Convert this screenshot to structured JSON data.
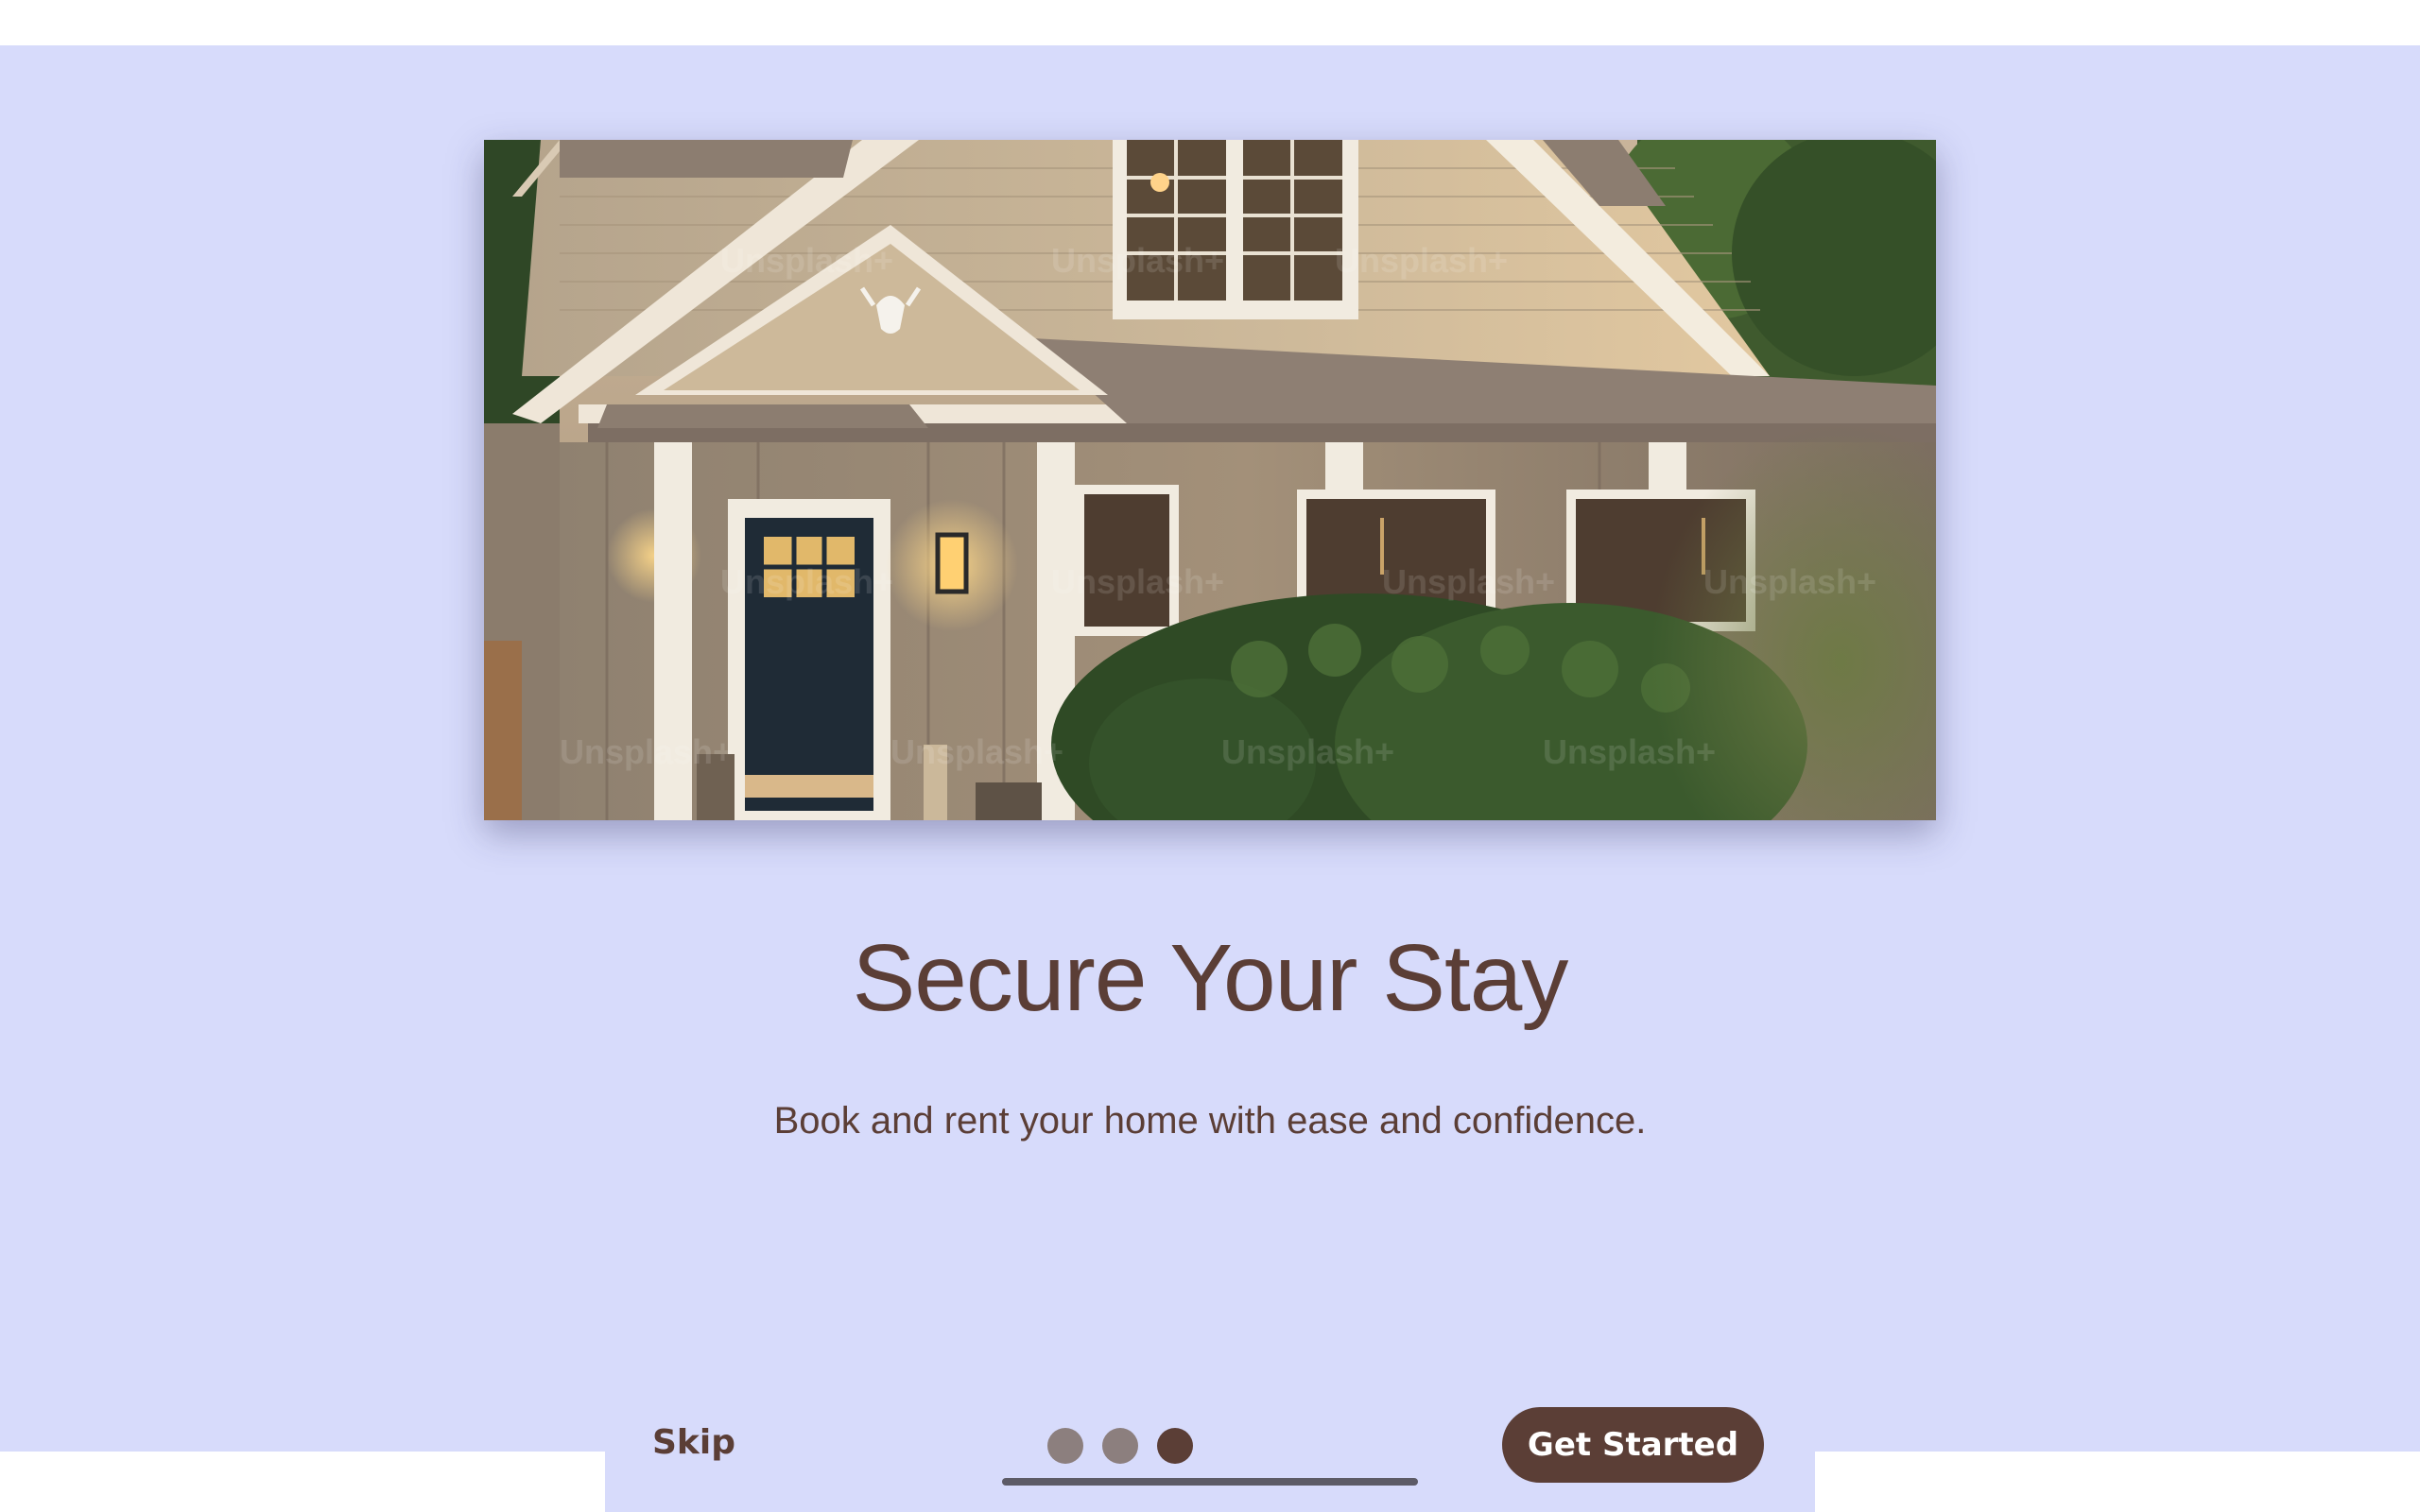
{
  "onboarding": {
    "hero_image": {
      "alt": "",
      "watermark": "Unsplash+"
    },
    "title": "Secure Your Stay",
    "subtitle": "Book and rent your home with ease and confidence.",
    "skip_label": "Skip",
    "cta_label": "Get Started",
    "pagination": {
      "total_pages": 3,
      "current_page": 3
    }
  },
  "colors": {
    "background": "#d7dbfb",
    "text": "#5b3e36",
    "button": "#5b3e36",
    "dot_inactive": "#8c7f7e",
    "dot_active": "#5b3e36"
  }
}
